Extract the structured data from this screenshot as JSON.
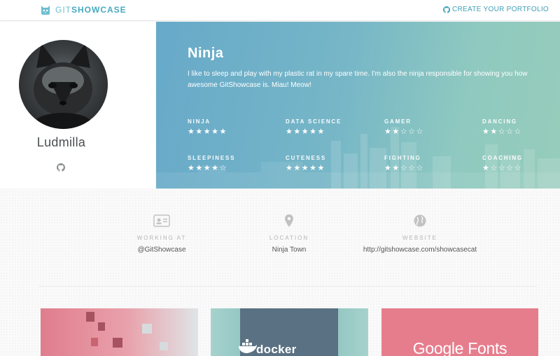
{
  "header": {
    "logo_light": "GIT",
    "logo_bold": "SHOWCASE",
    "create_portfolio": "CREATE YOUR PORTFOLIO"
  },
  "profile": {
    "name": "Ludmilla"
  },
  "hero": {
    "title": "Ninja",
    "description": "I like to sleep and play with my plastic rat in my spare time. I'm also the ninja responsible for showing you how awesome GitShowcase is. Miau! Meow!",
    "skills": [
      {
        "name": "NINJA",
        "rating": 5,
        "stars": "★★★★★"
      },
      {
        "name": "DATA SCIENCE",
        "rating": 5,
        "stars": "★★★★★"
      },
      {
        "name": "GAMER",
        "rating": 2,
        "stars": "★★☆☆☆"
      },
      {
        "name": "DANCING",
        "rating": 2,
        "stars": "★★☆☆☆"
      },
      {
        "name": "SLEEPINESS",
        "rating": 4,
        "stars": "★★★★☆"
      },
      {
        "name": "CUTENESS",
        "rating": 5,
        "stars": "★★★★★"
      },
      {
        "name": "FIGHTING",
        "rating": 2,
        "stars": "★★☆☆☆"
      },
      {
        "name": "COACHING",
        "rating": 1,
        "stars": "★☆☆☆☆"
      }
    ]
  },
  "info": {
    "working_label": "WORKING AT",
    "working_value": "@GitShowcase",
    "location_label": "LOCATION",
    "location_value": "Ninja Town",
    "website_label": "WEBSITE",
    "website_value": "http://gitshowcase.com/showcasecat"
  },
  "cards": {
    "docker": "docker",
    "google_fonts": "Google Fonts"
  },
  "colors": {
    "accent": "#47a9bf",
    "hero_start": "#67a9c9",
    "hero_end": "#96ccbb",
    "card_pink": "#e67d8d",
    "docker_panel": "#597182"
  },
  "icons": {
    "logo": "cat-logo-icon",
    "github": "github-icon",
    "id_card": "id-card-icon",
    "location": "map-pin-icon",
    "website": "globe-icon"
  }
}
